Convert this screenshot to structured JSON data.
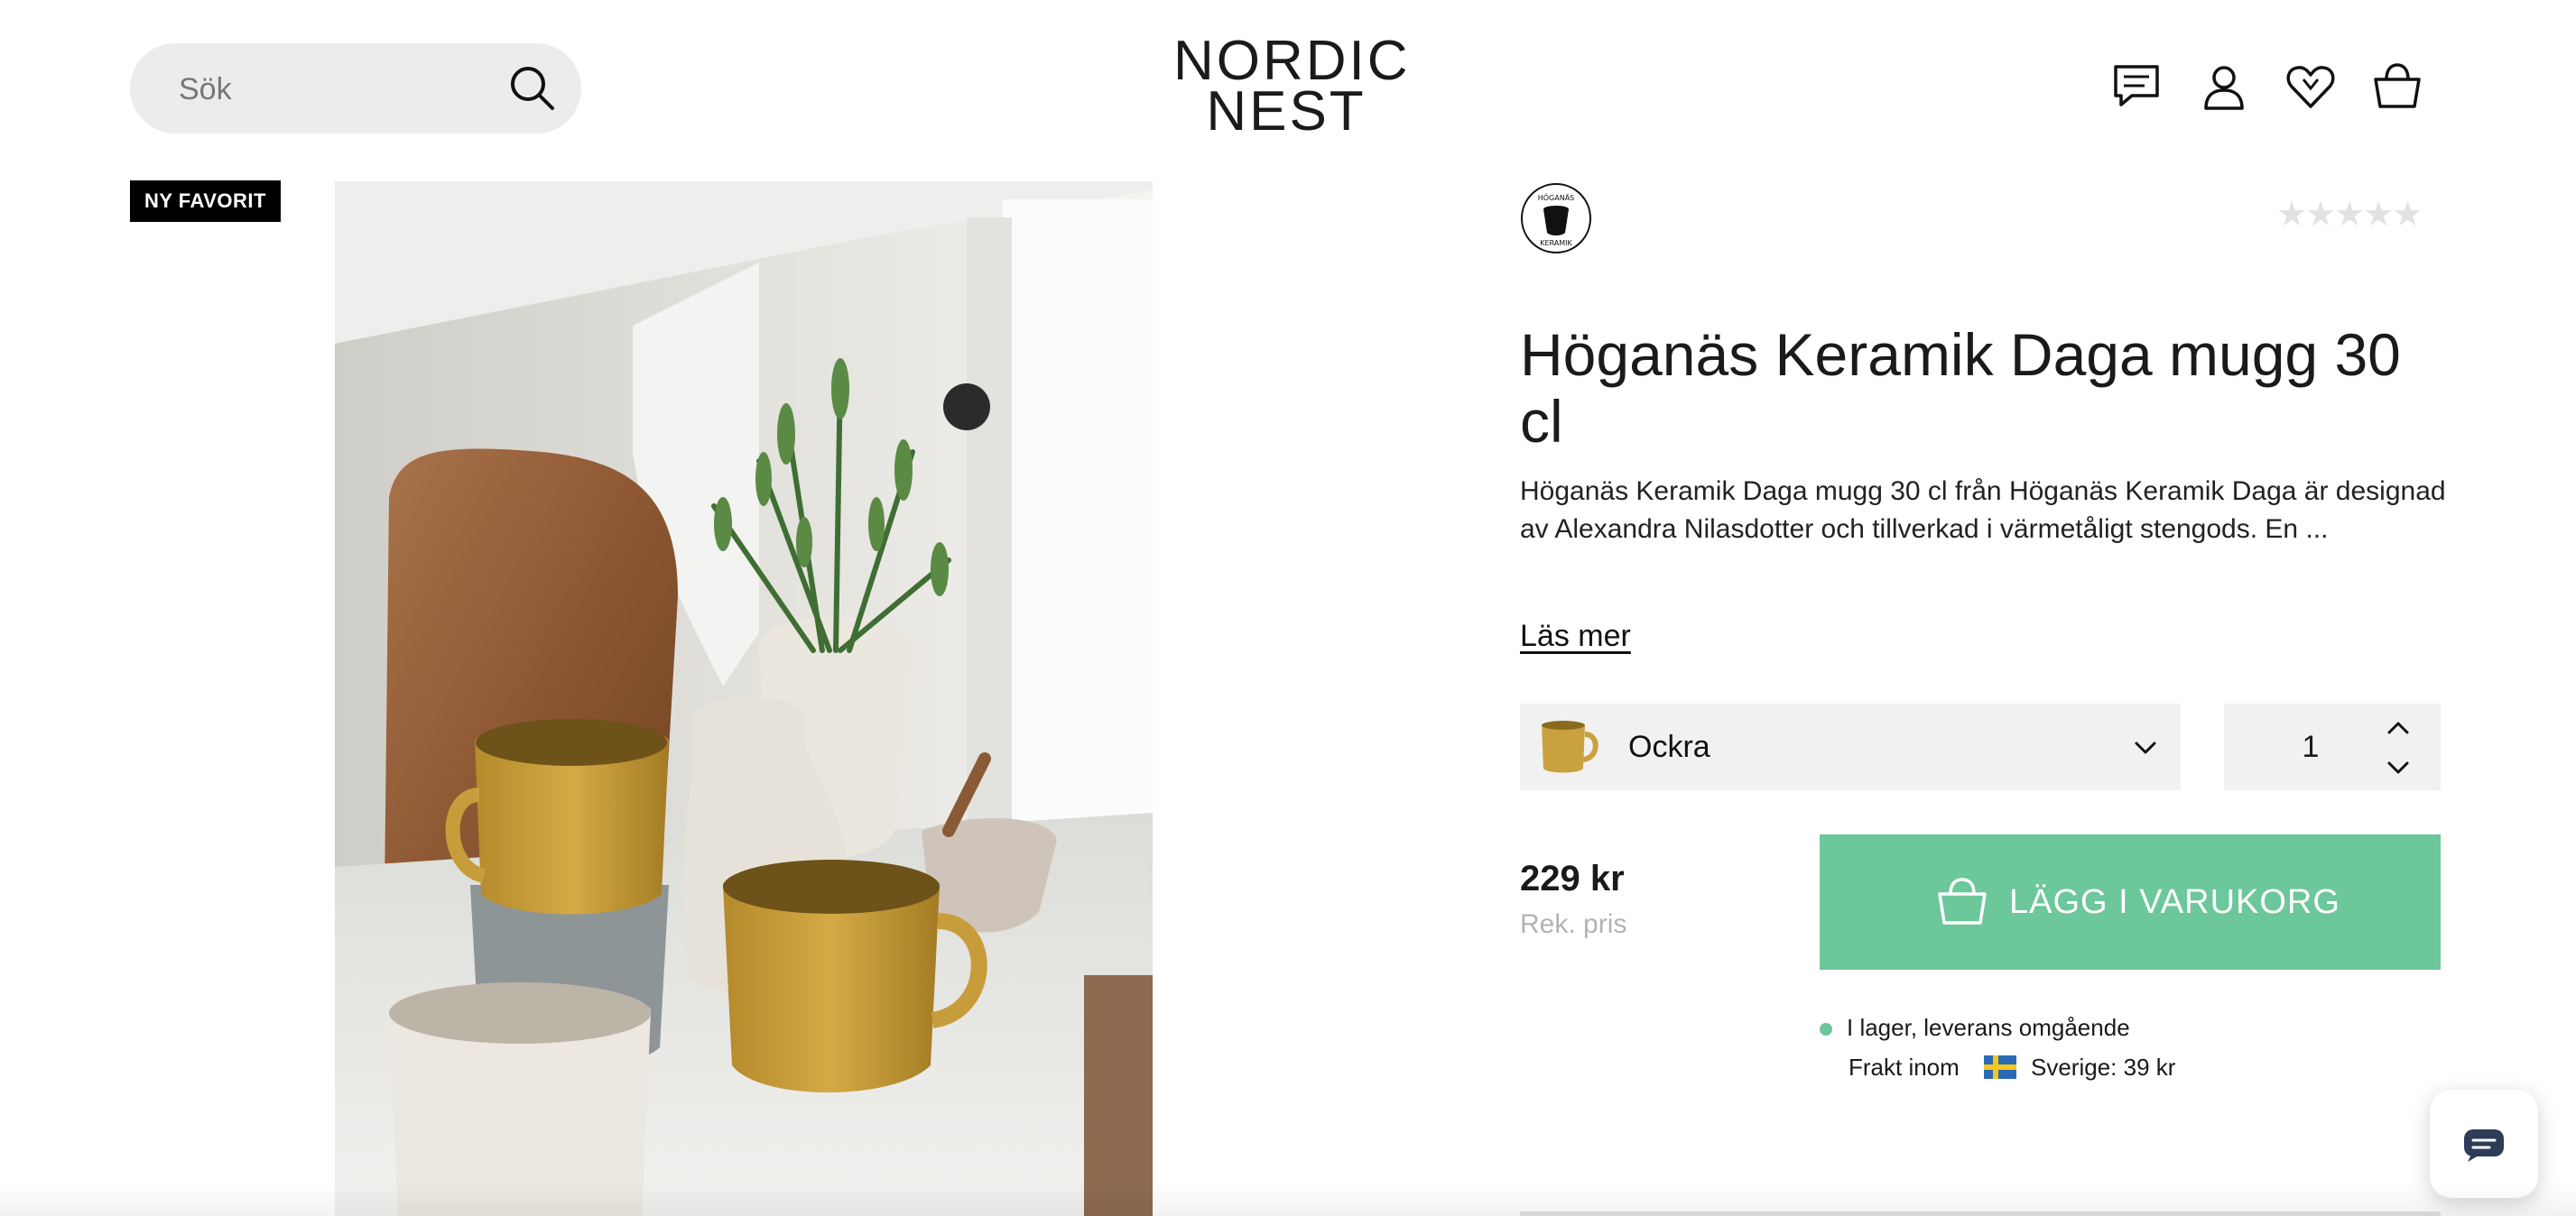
{
  "header": {
    "search": {
      "placeholder": "Sök"
    },
    "logo": {
      "line1": "NORDIC",
      "line2": "NEST"
    },
    "icons": [
      "chat-icon",
      "user-icon",
      "heart-icon",
      "basket-icon"
    ]
  },
  "gallery": {
    "badge": "NY FAVORIT",
    "image": "product-lifestyle-photo"
  },
  "product": {
    "brand_logo_text": "HÖGANÄS KERAMIK",
    "rating_stars": 5,
    "rating_value": 0,
    "title": "Höganäs Keramik Daga mugg 30 cl",
    "description": "Höganäs Keramik Daga mugg 30 cl från Höganäs Keramik Daga är designad av Alexandra Nilasdotter och tillverkad i värmetåligt stengods. En ...",
    "read_more": "Läs mer",
    "variant": {
      "selected": "Ockra",
      "swatch_color": "#c9a23f"
    },
    "quantity": "1",
    "price": "229 kr",
    "price_note": "Rek. pris",
    "add_to_cart": "LÄGG I VARUKORG",
    "stock": "I lager, leverans omgående",
    "shipping_prefix": "Frakt inom",
    "shipping_country": "Sverige: 39 kr"
  },
  "colors": {
    "accent": "#6cc79a",
    "badge_bg": "#000000",
    "field_bg": "#f1f1f1",
    "star_empty": "#e2e2e2"
  }
}
